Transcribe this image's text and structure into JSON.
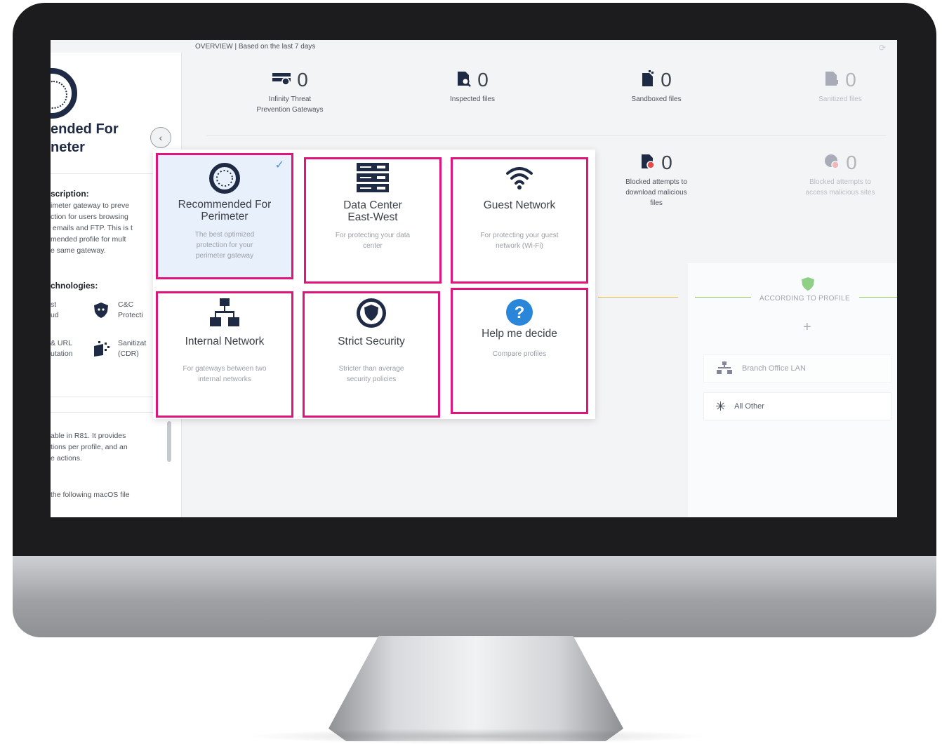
{
  "overview": {
    "title": "OVERVIEW | Based on the last 7 days",
    "stats": [
      {
        "icon": "gateway-icon",
        "value": "0",
        "label": "Infinity Threat\nPrevention Gateways"
      },
      {
        "icon": "inspected-file-icon",
        "value": "0",
        "label": "Inspected files"
      },
      {
        "icon": "sandboxed-file-icon",
        "value": "0",
        "label": "Sandboxed files"
      },
      {
        "icon": "sanitized-file-icon",
        "value": "0",
        "label": "Sanitized files"
      },
      {
        "icon": "blocked-download-icon",
        "value": "0",
        "label": "Blocked attempts to\ndownload malicious\nfiles"
      },
      {
        "icon": "blocked-access-icon",
        "value": "0",
        "label": "Blocked attempts to\naccess malicious sites"
      }
    ]
  },
  "side_panel": {
    "title_line1": "ended For",
    "title_line2": "neter",
    "description_label": "scription:",
    "description_text": "imeter gateway to preve\nction for users browsing\n emails and FTP. This is t\nmended profile for mult\ne same gateway.",
    "technologies_label": "chnologies:",
    "tech": [
      {
        "left": "st\nud",
        "right": "C&C\nProtecti",
        "icon": "cnc-shield-icon"
      },
      {
        "left": "& URL\nutation",
        "right": "Sanitizat\n(CDR)",
        "icon": "cdr-icon"
      }
    ],
    "release_text": "able in R81. It provides\ntions per profile, and an\ne actions.",
    "macos_text": "the following macOS file"
  },
  "profile_picker": {
    "cards": [
      {
        "name": "recommended-for-perimeter",
        "title": "Recommended For\nPerimeter",
        "desc": "The best optimized\nprotection for your\nperimeter gateway",
        "selected": true
      },
      {
        "name": "data-center-east-west",
        "title": "Data Center\nEast-West",
        "desc": "For protecting your data\ncenter"
      },
      {
        "name": "guest-network",
        "title": "Guest Network",
        "desc": "For protecting your guest\nnetwork (Wi-Fi)"
      },
      {
        "name": "internal-network",
        "title": "Internal Network",
        "desc": "For gateways between two\ninternal networks"
      },
      {
        "name": "strict-security",
        "title": "Strict Security",
        "desc": "Stricter than average\nsecurity policies"
      },
      {
        "name": "help-me-decide",
        "title": "Help me decide",
        "desc": "Compare profiles"
      }
    ]
  },
  "policy_panel": {
    "according_label": "ACCORDING TO PROFILE",
    "rows": [
      {
        "label": "Branch Office LAN",
        "icon": "network-icon"
      },
      {
        "label": "All Other",
        "icon": "asterisk-icon"
      }
    ]
  },
  "colors": {
    "highlight_border": "#e0147a",
    "selected_card_bg": "#e8f1fb",
    "navy": "#1f2a44",
    "help_blue": "#2a86d8"
  }
}
